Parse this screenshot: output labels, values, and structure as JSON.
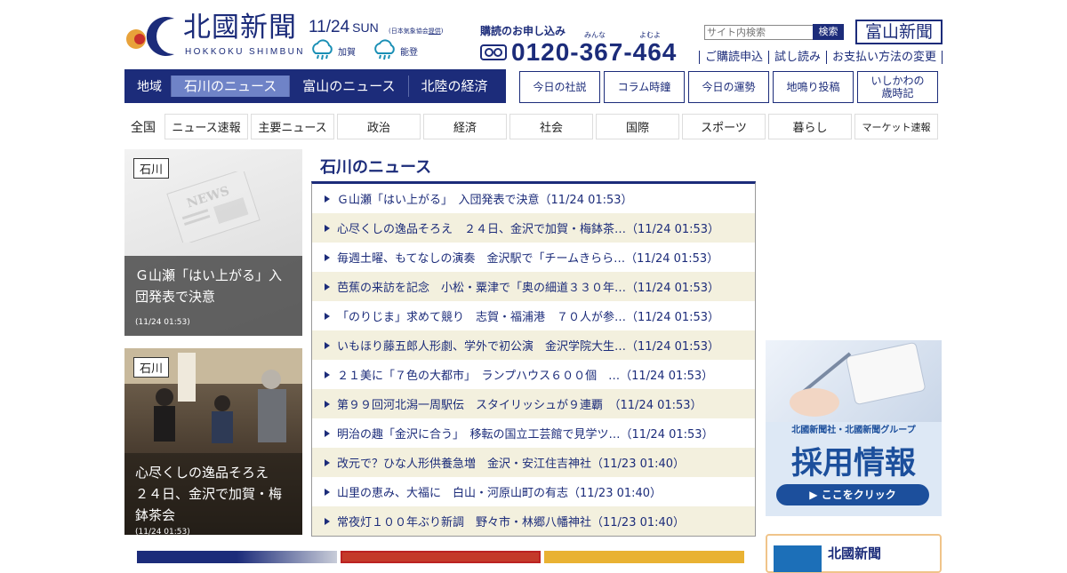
{
  "header": {
    "logo_kanji": "北國新聞",
    "logo_roman": "HOKKOKU SHIMBUN",
    "date": "11/24",
    "weekday": "SUN",
    "weather_note": "(日本気象協会",
    "weather_note_link": "提供",
    "weather_note_end": ")",
    "weather": [
      {
        "icon": "rain-cloud-icon",
        "label": "加賀"
      },
      {
        "icon": "rain-cloud-icon",
        "label": "能登"
      }
    ],
    "subscribe_title": "購読のお申し込み",
    "ruby_minna": "みんな",
    "ruby_yomu": "よむよ",
    "phone": "0120-367-464",
    "search_placeholder": "サイト内検索",
    "search_button": "検索",
    "toyama_button": "富山新聞",
    "links": [
      "ご購読申込",
      "試し読み",
      "お支払い方法の変更"
    ]
  },
  "region_nav": {
    "label": "地域",
    "tabs": [
      "石川のニュース",
      "富山のニュース",
      "北陸の経済"
    ]
  },
  "box_buttons": [
    "今日の社説",
    "コラム時鐘",
    "今日の運勢",
    "地鳴り投稿",
    "いしかわの\n歳時記"
  ],
  "category_nav": {
    "label": "全国",
    "items": [
      "ニュース速報",
      "主要ニュース",
      "政治",
      "経済",
      "社会",
      "国際",
      "スポーツ",
      "暮らし",
      "マーケット速報"
    ]
  },
  "cards": [
    {
      "tag": "石川",
      "title": "Ｇ山瀬「はい上がる」入団発表で決意",
      "date": "(11/24 01:53)"
    },
    {
      "tag": "石川",
      "title": "心尽くしの逸品そろえ　２４日、金沢で加賀・梅鉢茶会",
      "date": "(11/24 01:53)"
    }
  ],
  "main": {
    "title": "石川のニュース",
    "items": [
      {
        "text": "Ｇ山瀬「はい上がる」　入団発表で決意（11/24 01:53）"
      },
      {
        "text": "心尽くしの逸品そろえ　２４日、金沢で加賀・梅鉢茶…（11/24 01:53）"
      },
      {
        "text": "毎週土曜、もてなしの演奏　金沢駅で「チームきらら…（11/24 01:53）"
      },
      {
        "text": "芭蕉の来訪を記念　小松・粟津で「奥の細道３３０年…（11/24 01:53）"
      },
      {
        "text": "「のりじま」求めて競り　志賀・福浦港　７０人が参…（11/24 01:53）"
      },
      {
        "text": "いもほり藤五郎人形劇、学外で初公演　金沢学院大生…（11/24 01:53）"
      },
      {
        "text": "２１美に「７色の大都市」　ランプハウス６００個　…（11/24 01:53）"
      },
      {
        "text": "第９９回河北潟一周駅伝　スタイリッシュが９連覇　（11/24 01:53）"
      },
      {
        "text": "明治の趣「金沢に合う」　移転の国立工芸館で見学ツ…（11/24 01:53）"
      },
      {
        "text": "改元で？ひな人形供養急増　金沢・安江住吉神社（11/23 01:40）"
      },
      {
        "text": "山里の恵み、大福に　白山・河原山町の有志（11/23 01:40）"
      },
      {
        "text": "常夜灯１００年ぶり新調　野々市・林郷八幡神社（11/23 01:40）"
      }
    ]
  },
  "banner": {
    "sub": "北國新聞社・北國新聞グループ",
    "big": "採用情報",
    "cta": "▶ ここをクリック"
  },
  "news_box": {
    "title": "北國新聞"
  },
  "colors": {
    "brand_navy": "#1c2c7a",
    "active_tab": "#6f83c7",
    "row_alt": "#f3f0de"
  }
}
